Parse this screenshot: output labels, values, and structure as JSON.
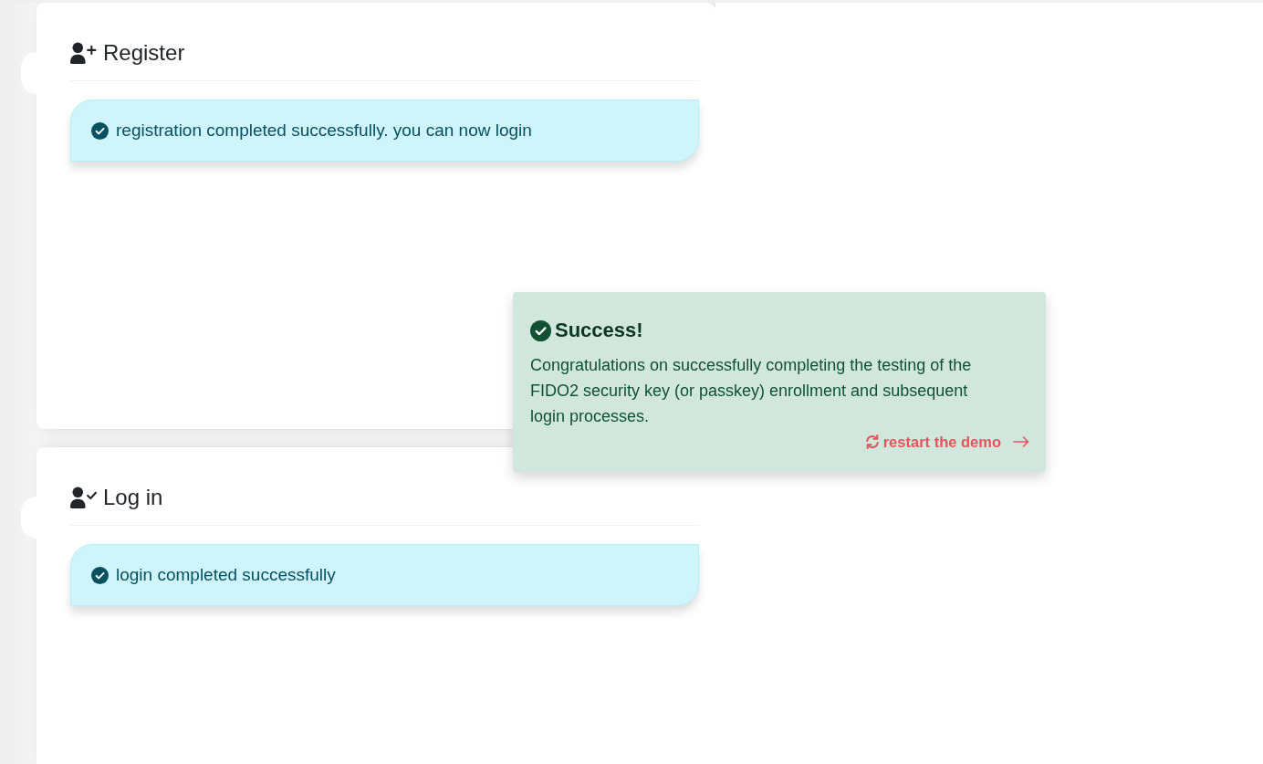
{
  "steps": [
    {
      "kind": "register",
      "title": "Register",
      "alert": {
        "kind": "info",
        "message": "registration completed successfully. you can now login"
      }
    },
    {
      "kind": "login",
      "title": "Log in",
      "alert": {
        "kind": "info",
        "message": "login completed successfully"
      }
    }
  ],
  "toast": {
    "kind": "success",
    "title": "Success!",
    "message": "Congratulations on successfully completing the testing of the FIDO2 security key (or passkey) enrollment and subsequent login processes.",
    "link": "restart the demo"
  }
}
